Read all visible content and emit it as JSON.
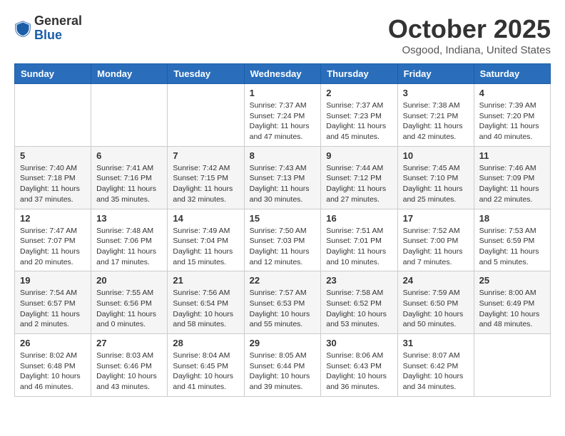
{
  "header": {
    "logo_general": "General",
    "logo_blue": "Blue",
    "month_title": "October 2025",
    "location": "Osgood, Indiana, United States"
  },
  "weekdays": [
    "Sunday",
    "Monday",
    "Tuesday",
    "Wednesday",
    "Thursday",
    "Friday",
    "Saturday"
  ],
  "weeks": [
    [
      {
        "day": "",
        "info": ""
      },
      {
        "day": "",
        "info": ""
      },
      {
        "day": "",
        "info": ""
      },
      {
        "day": "1",
        "info": "Sunrise: 7:37 AM\nSunset: 7:24 PM\nDaylight: 11 hours\nand 47 minutes."
      },
      {
        "day": "2",
        "info": "Sunrise: 7:37 AM\nSunset: 7:23 PM\nDaylight: 11 hours\nand 45 minutes."
      },
      {
        "day": "3",
        "info": "Sunrise: 7:38 AM\nSunset: 7:21 PM\nDaylight: 11 hours\nand 42 minutes."
      },
      {
        "day": "4",
        "info": "Sunrise: 7:39 AM\nSunset: 7:20 PM\nDaylight: 11 hours\nand 40 minutes."
      }
    ],
    [
      {
        "day": "5",
        "info": "Sunrise: 7:40 AM\nSunset: 7:18 PM\nDaylight: 11 hours\nand 37 minutes."
      },
      {
        "day": "6",
        "info": "Sunrise: 7:41 AM\nSunset: 7:16 PM\nDaylight: 11 hours\nand 35 minutes."
      },
      {
        "day": "7",
        "info": "Sunrise: 7:42 AM\nSunset: 7:15 PM\nDaylight: 11 hours\nand 32 minutes."
      },
      {
        "day": "8",
        "info": "Sunrise: 7:43 AM\nSunset: 7:13 PM\nDaylight: 11 hours\nand 30 minutes."
      },
      {
        "day": "9",
        "info": "Sunrise: 7:44 AM\nSunset: 7:12 PM\nDaylight: 11 hours\nand 27 minutes."
      },
      {
        "day": "10",
        "info": "Sunrise: 7:45 AM\nSunset: 7:10 PM\nDaylight: 11 hours\nand 25 minutes."
      },
      {
        "day": "11",
        "info": "Sunrise: 7:46 AM\nSunset: 7:09 PM\nDaylight: 11 hours\nand 22 minutes."
      }
    ],
    [
      {
        "day": "12",
        "info": "Sunrise: 7:47 AM\nSunset: 7:07 PM\nDaylight: 11 hours\nand 20 minutes."
      },
      {
        "day": "13",
        "info": "Sunrise: 7:48 AM\nSunset: 7:06 PM\nDaylight: 11 hours\nand 17 minutes."
      },
      {
        "day": "14",
        "info": "Sunrise: 7:49 AM\nSunset: 7:04 PM\nDaylight: 11 hours\nand 15 minutes."
      },
      {
        "day": "15",
        "info": "Sunrise: 7:50 AM\nSunset: 7:03 PM\nDaylight: 11 hours\nand 12 minutes."
      },
      {
        "day": "16",
        "info": "Sunrise: 7:51 AM\nSunset: 7:01 PM\nDaylight: 11 hours\nand 10 minutes."
      },
      {
        "day": "17",
        "info": "Sunrise: 7:52 AM\nSunset: 7:00 PM\nDaylight: 11 hours\nand 7 minutes."
      },
      {
        "day": "18",
        "info": "Sunrise: 7:53 AM\nSunset: 6:59 PM\nDaylight: 11 hours\nand 5 minutes."
      }
    ],
    [
      {
        "day": "19",
        "info": "Sunrise: 7:54 AM\nSunset: 6:57 PM\nDaylight: 11 hours\nand 2 minutes."
      },
      {
        "day": "20",
        "info": "Sunrise: 7:55 AM\nSunset: 6:56 PM\nDaylight: 11 hours\nand 0 minutes."
      },
      {
        "day": "21",
        "info": "Sunrise: 7:56 AM\nSunset: 6:54 PM\nDaylight: 10 hours\nand 58 minutes."
      },
      {
        "day": "22",
        "info": "Sunrise: 7:57 AM\nSunset: 6:53 PM\nDaylight: 10 hours\nand 55 minutes."
      },
      {
        "day": "23",
        "info": "Sunrise: 7:58 AM\nSunset: 6:52 PM\nDaylight: 10 hours\nand 53 minutes."
      },
      {
        "day": "24",
        "info": "Sunrise: 7:59 AM\nSunset: 6:50 PM\nDaylight: 10 hours\nand 50 minutes."
      },
      {
        "day": "25",
        "info": "Sunrise: 8:00 AM\nSunset: 6:49 PM\nDaylight: 10 hours\nand 48 minutes."
      }
    ],
    [
      {
        "day": "26",
        "info": "Sunrise: 8:02 AM\nSunset: 6:48 PM\nDaylight: 10 hours\nand 46 minutes."
      },
      {
        "day": "27",
        "info": "Sunrise: 8:03 AM\nSunset: 6:46 PM\nDaylight: 10 hours\nand 43 minutes."
      },
      {
        "day": "28",
        "info": "Sunrise: 8:04 AM\nSunset: 6:45 PM\nDaylight: 10 hours\nand 41 minutes."
      },
      {
        "day": "29",
        "info": "Sunrise: 8:05 AM\nSunset: 6:44 PM\nDaylight: 10 hours\nand 39 minutes."
      },
      {
        "day": "30",
        "info": "Sunrise: 8:06 AM\nSunset: 6:43 PM\nDaylight: 10 hours\nand 36 minutes."
      },
      {
        "day": "31",
        "info": "Sunrise: 8:07 AM\nSunset: 6:42 PM\nDaylight: 10 hours\nand 34 minutes."
      },
      {
        "day": "",
        "info": ""
      }
    ]
  ]
}
